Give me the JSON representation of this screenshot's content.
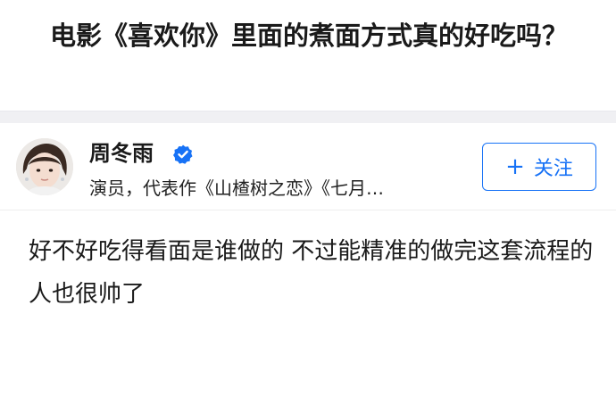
{
  "question": {
    "title": "电影《喜欢你》里面的煮面方式真的好吃吗？"
  },
  "author": {
    "name": "周冬雨",
    "verified_icon": "verified-badge-icon",
    "description": "演员，代表作《山楂树之恋》《七月…"
  },
  "follow_button": {
    "icon": "plus-icon",
    "icon_glyph": "+",
    "label": "关注"
  },
  "answer": {
    "content": "好不好吃得看面是谁做的 不过能精准的做完这套流程的人也很帅了"
  },
  "colors": {
    "accent": "#1772f6",
    "band": "#f0f0f3",
    "text": "#1a1a1a"
  }
}
